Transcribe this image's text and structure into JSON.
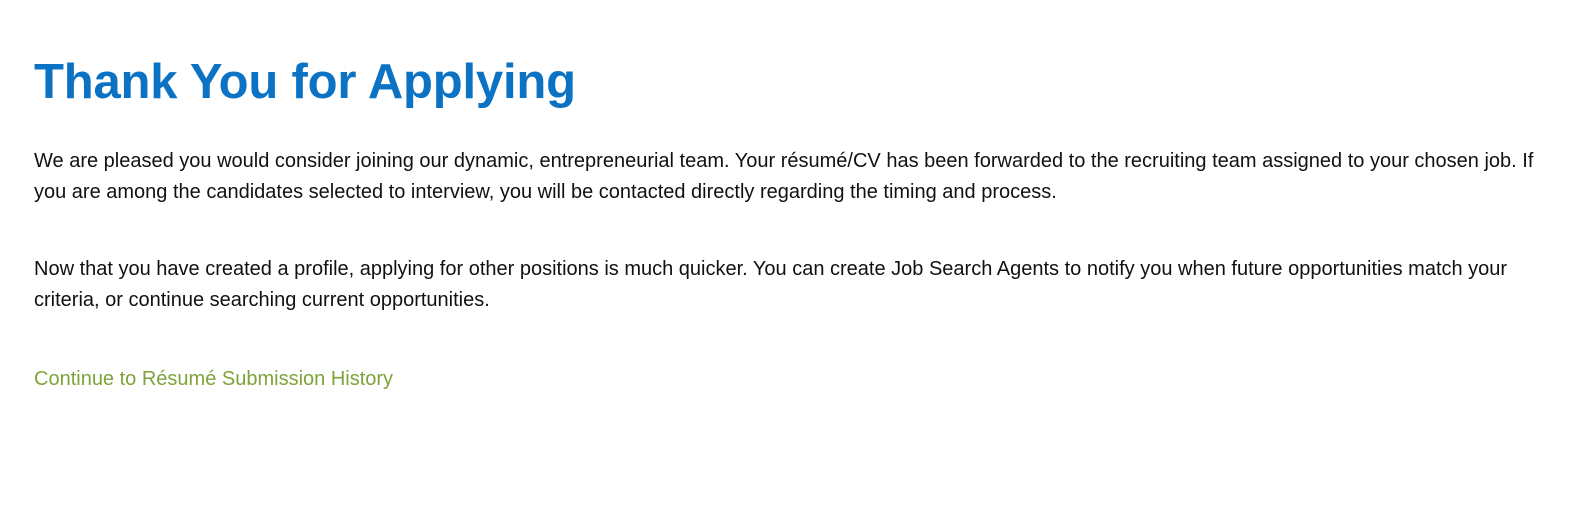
{
  "confirmation": {
    "title": "Thank You for Applying",
    "paragraph_1": "We are pleased you would consider joining our dynamic, entrepreneurial team. Your résumé/CV has been forwarded to the recruiting team assigned to your chosen job. If you are among the candidates selected to interview, you will be contacted directly regarding the timing and process.",
    "paragraph_2": "Now that you have created a profile, applying for other positions is much quicker. You can create Job Search Agents to notify you when future opportunities match your criteria, or continue searching current opportunities.",
    "continue_link_label": "Continue to Résumé Submission History"
  },
  "colors": {
    "title": "#0b72c4",
    "body_text": "#111111",
    "link": "#7fa33a",
    "background": "#ffffff"
  }
}
